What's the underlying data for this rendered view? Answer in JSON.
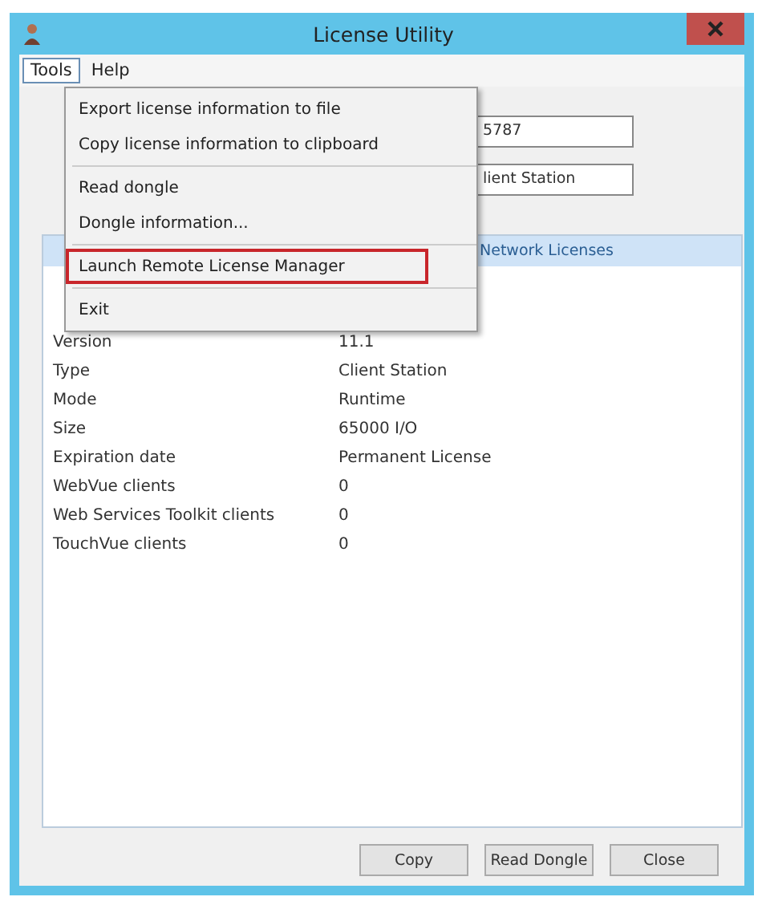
{
  "window": {
    "title": "License Utility"
  },
  "menu_bar": [
    {
      "label": "Tools",
      "selected": true
    },
    {
      "label": "Help",
      "selected": false
    }
  ],
  "open_menu": {
    "groups": [
      [
        {
          "label": "Export license information to file",
          "highlighted": false
        },
        {
          "label": "Copy license information to clipboard",
          "highlighted": false
        }
      ],
      [
        {
          "label": "Read dongle",
          "highlighted": false
        },
        {
          "label": "Dongle information...",
          "highlighted": false
        }
      ],
      [
        {
          "label": "Launch Remote License Manager",
          "highlighted": true
        }
      ],
      [
        {
          "label": "Exit",
          "highlighted": false
        }
      ]
    ]
  },
  "fields": [
    "5787",
    "lient Station"
  ],
  "list_header": "Network Licenses",
  "properties": [
    {
      "name": "Version",
      "value": "11.1"
    },
    {
      "name": "Type",
      "value": "Client Station"
    },
    {
      "name": "Mode",
      "value": "Runtime"
    },
    {
      "name": "Size",
      "value": "65000 I/O"
    },
    {
      "name": "Expiration date",
      "value": "Permanent License"
    },
    {
      "name": "WebVue clients",
      "value": "0"
    },
    {
      "name": "Web Services Toolkit clients",
      "value": "0"
    },
    {
      "name": "TouchVue clients",
      "value": "0"
    }
  ],
  "buttons": [
    "Copy",
    "Read Dongle",
    "Close"
  ]
}
